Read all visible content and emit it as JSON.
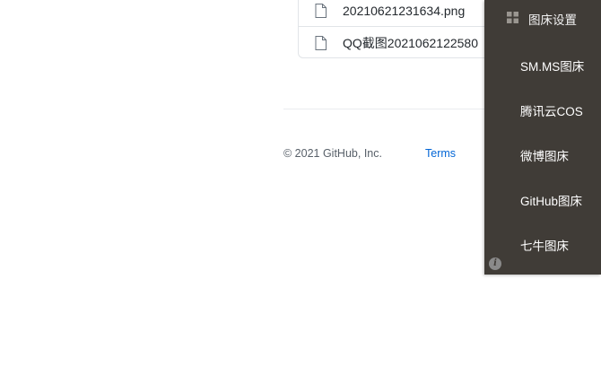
{
  "files": [
    {
      "name": "20210621231634.png",
      "icon": "file-icon"
    },
    {
      "name": "QQ截图2021062122580",
      "icon": "file-icon"
    }
  ],
  "footer": {
    "copyright": "© 2021 GitHub, Inc.",
    "terms": "Terms"
  },
  "panel": {
    "title": "图床设置",
    "title_icon": "grid-icon",
    "items": [
      {
        "label": "SM.MS图床"
      },
      {
        "label": "腾讯云COS"
      },
      {
        "label": "微博图床"
      },
      {
        "label": "GitHub图床"
      },
      {
        "label": "七牛图床"
      }
    ],
    "info_icon_glyph": "i",
    "background": "#403c37"
  },
  "colors": {
    "link": "#0366d6",
    "text": "#24292e",
    "muted": "#586069",
    "border": "#e1e4e8"
  }
}
